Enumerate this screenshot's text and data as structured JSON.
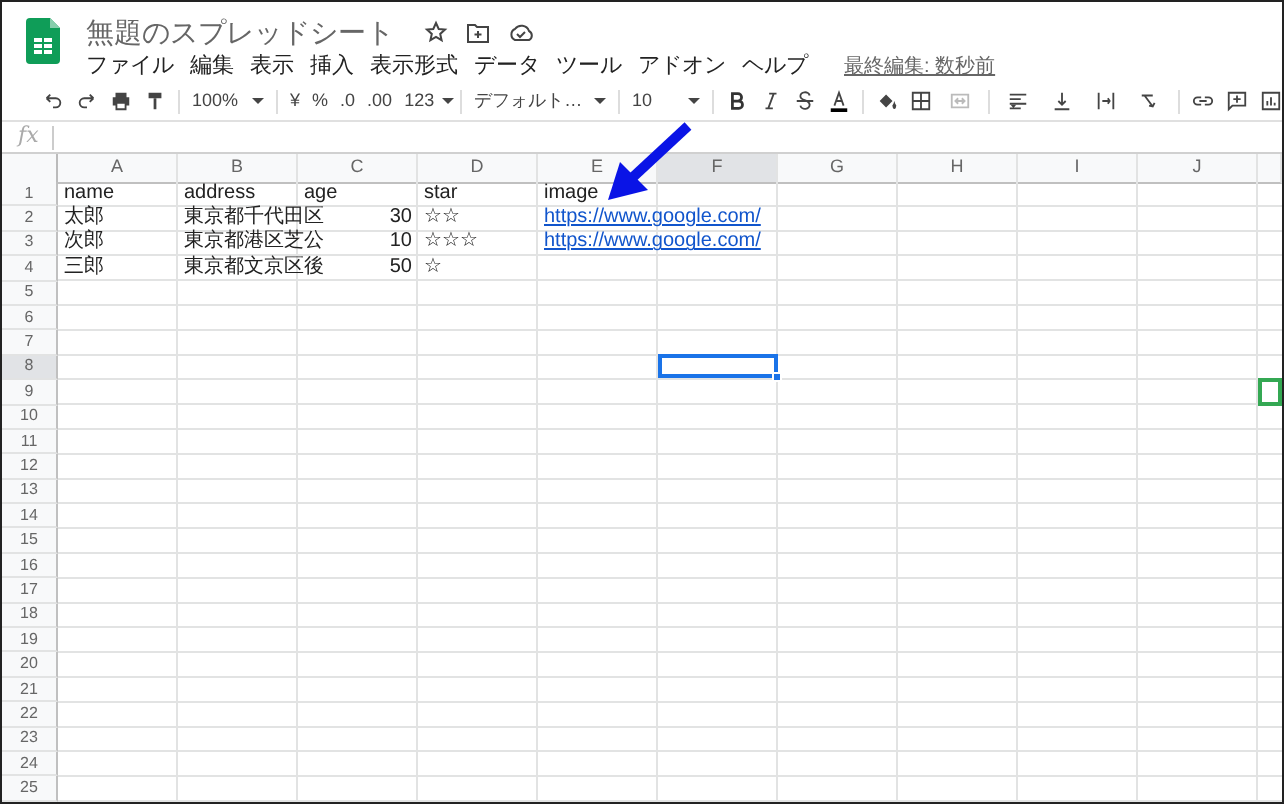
{
  "document": {
    "title": "無題のスプレッドシート",
    "last_edit": "最終編集: 数秒前"
  },
  "menu": [
    "ファイル",
    "編集",
    "表示",
    "挿入",
    "表示形式",
    "データ",
    "ツール",
    "アドオン",
    "ヘルプ"
  ],
  "toolbar": {
    "zoom": "100%",
    "currency": "¥",
    "percent": "%",
    "decrease_decimal": ".0",
    "increase_decimal": ".00",
    "number_format": "123",
    "font": "デフォルト…",
    "font_size": "10"
  },
  "formula_bar": {
    "label": "fx"
  },
  "columns": [
    {
      "label": "A",
      "selected": false
    },
    {
      "label": "B",
      "selected": false
    },
    {
      "label": "C",
      "selected": false
    },
    {
      "label": "D",
      "selected": false
    },
    {
      "label": "E",
      "selected": false
    },
    {
      "label": "F",
      "selected": true
    },
    {
      "label": "G",
      "selected": false
    },
    {
      "label": "H",
      "selected": false
    },
    {
      "label": "I",
      "selected": false
    },
    {
      "label": "J",
      "selected": false
    }
  ],
  "rows": [
    {
      "number": "1",
      "selected": false,
      "remote_cursor": false,
      "cells": [
        {
          "kind": "text",
          "text": "name"
        },
        {
          "kind": "text",
          "text": "address"
        },
        {
          "kind": "text",
          "text": "age"
        },
        {
          "kind": "text",
          "text": "star"
        },
        {
          "kind": "text",
          "text": "image"
        }
      ]
    },
    {
      "number": "2",
      "selected": false,
      "remote_cursor": false,
      "cells": [
        {
          "kind": "text",
          "text": "太郎"
        },
        {
          "kind": "text",
          "text": "東京都千代田区"
        },
        {
          "kind": "number",
          "text": "30"
        },
        {
          "kind": "text",
          "text": "☆☆"
        },
        {
          "kind": "link",
          "text": "https://www.google.com/"
        }
      ]
    },
    {
      "number": "3",
      "selected": false,
      "remote_cursor": false,
      "cells": [
        {
          "kind": "text",
          "text": "次郎"
        },
        {
          "kind": "text",
          "text": "東京都港区芝公"
        },
        {
          "kind": "number",
          "text": "10"
        },
        {
          "kind": "text",
          "text": "☆☆☆"
        },
        {
          "kind": "link",
          "text": "https://www.google.com/"
        }
      ]
    },
    {
      "number": "4",
      "selected": false,
      "remote_cursor": false,
      "cells": [
        {
          "kind": "text",
          "text": "三郎"
        },
        {
          "kind": "text",
          "text": "東京都文京区後"
        },
        {
          "kind": "number",
          "text": "50"
        },
        {
          "kind": "text",
          "text": "☆"
        }
      ]
    },
    {
      "number": "5",
      "selected": false,
      "remote_cursor": false
    },
    {
      "number": "6",
      "selected": false,
      "remote_cursor": false
    },
    {
      "number": "7",
      "selected": false,
      "remote_cursor": false
    },
    {
      "number": "8",
      "selected": true,
      "remote_cursor": false
    },
    {
      "number": "9",
      "selected": false,
      "remote_cursor": true
    },
    {
      "number": "10",
      "selected": false,
      "remote_cursor": false
    },
    {
      "number": "11",
      "selected": false,
      "remote_cursor": false
    },
    {
      "number": "12",
      "selected": false,
      "remote_cursor": false
    },
    {
      "number": "13",
      "selected": false,
      "remote_cursor": false
    },
    {
      "number": "14",
      "selected": false,
      "remote_cursor": false
    },
    {
      "number": "15",
      "selected": false,
      "remote_cursor": false
    },
    {
      "number": "16",
      "selected": false,
      "remote_cursor": false
    },
    {
      "number": "17",
      "selected": false,
      "remote_cursor": false
    },
    {
      "number": "18",
      "selected": false,
      "remote_cursor": false
    },
    {
      "number": "19",
      "selected": false,
      "remote_cursor": false
    },
    {
      "number": "20",
      "selected": false,
      "remote_cursor": false
    },
    {
      "number": "21",
      "selected": false,
      "remote_cursor": false
    },
    {
      "number": "22",
      "selected": false,
      "remote_cursor": false
    },
    {
      "number": "23",
      "selected": false,
      "remote_cursor": false
    },
    {
      "number": "24",
      "selected": false,
      "remote_cursor": false
    },
    {
      "number": "25",
      "selected": false,
      "remote_cursor": false
    }
  ]
}
